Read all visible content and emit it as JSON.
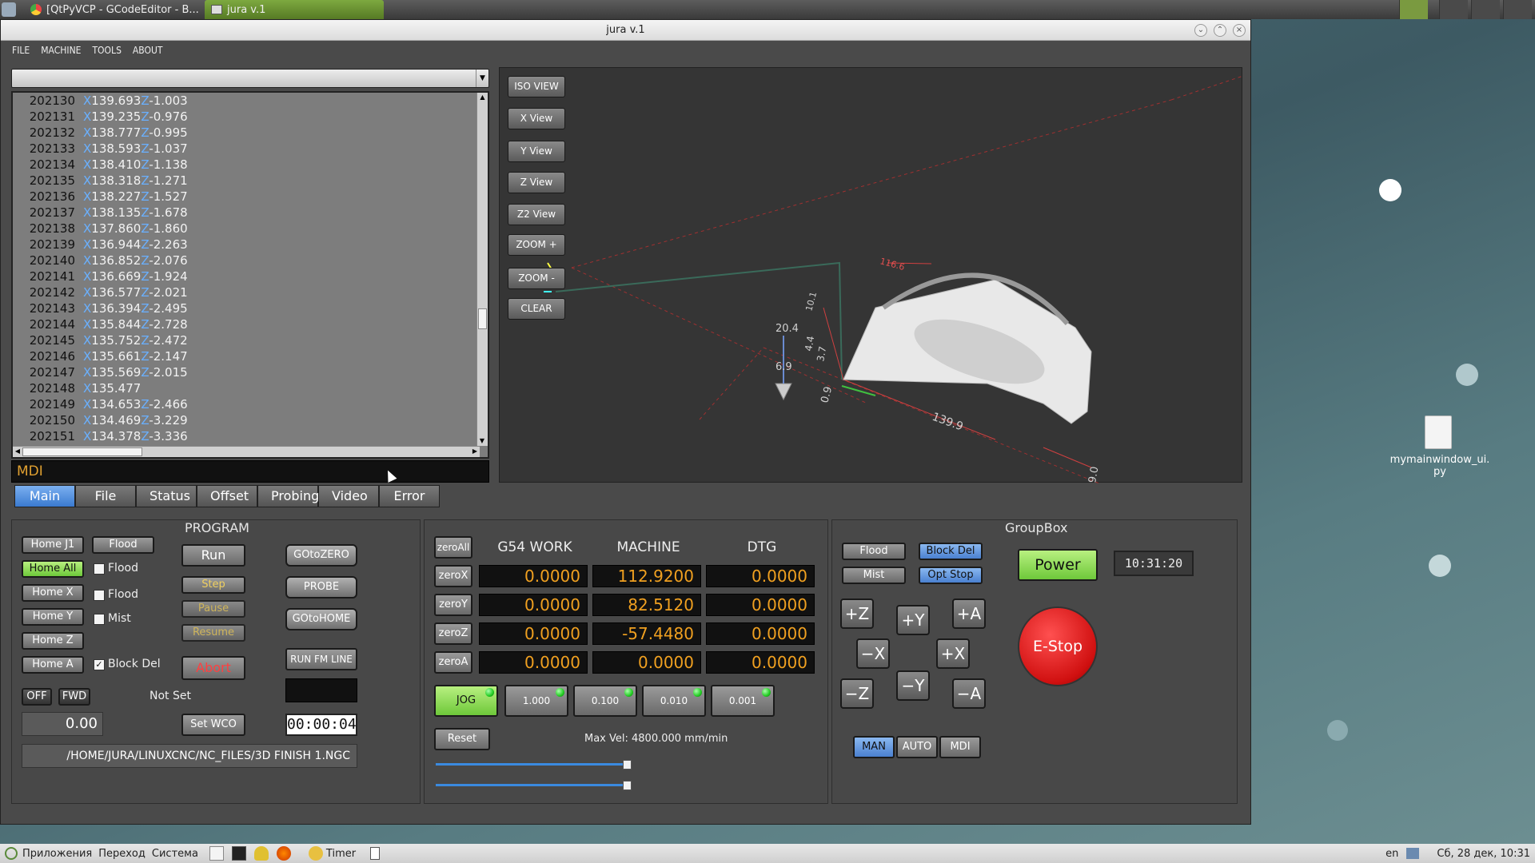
{
  "taskbar_top": {
    "tabs": [
      "[QtPyVCP - GCodeEditor - B...",
      "jura v.1"
    ]
  },
  "window": {
    "title": "jura v.1"
  },
  "menu": [
    "FILE",
    "MACHINE",
    "TOOLS",
    "ABOUT"
  ],
  "gcode_lines": [
    {
      "n": "202130",
      "x": "139.693",
      "z": "-1.003"
    },
    {
      "n": "202131",
      "x": "139.235",
      "z": "-0.976"
    },
    {
      "n": "202132",
      "x": "138.777",
      "z": "-0.995"
    },
    {
      "n": "202133",
      "x": "138.593",
      "z": "-1.037"
    },
    {
      "n": "202134",
      "x": "138.410",
      "z": "-1.138"
    },
    {
      "n": "202135",
      "x": "138.318",
      "z": "-1.271"
    },
    {
      "n": "202136",
      "x": "138.227",
      "z": "-1.527"
    },
    {
      "n": "202137",
      "x": "138.135",
      "z": "-1.678"
    },
    {
      "n": "202138",
      "x": "137.860",
      "z": "-1.860"
    },
    {
      "n": "202139",
      "x": "136.944",
      "z": "-2.263"
    },
    {
      "n": "202140",
      "x": "136.852",
      "z": "-2.076"
    },
    {
      "n": "202141",
      "x": "136.669",
      "z": "-1.924"
    },
    {
      "n": "202142",
      "x": "136.577",
      "z": "-2.021"
    },
    {
      "n": "202143",
      "x": "136.394",
      "z": "-2.495"
    },
    {
      "n": "202144",
      "x": "135.844",
      "z": "-2.728"
    },
    {
      "n": "202145",
      "x": "135.752",
      "z": "-2.472"
    },
    {
      "n": "202146",
      "x": "135.661",
      "z": "-2.147"
    },
    {
      "n": "202147",
      "x": "135.569",
      "z": "-2.015"
    },
    {
      "n": "202148",
      "x": "135.477",
      "z": ""
    },
    {
      "n": "202149",
      "x": "134.653",
      "z": "-2.466"
    },
    {
      "n": "202150",
      "x": "134.469",
      "z": "-3.229"
    },
    {
      "n": "202151",
      "x": "134.378",
      "z": "-3.336"
    }
  ],
  "mdi": {
    "label": "MDI"
  },
  "view_buttons": [
    "ISO VIEW",
    "X View",
    "Y View",
    "Z View",
    "Z2 View",
    "ZOOM +",
    "ZOOM -",
    "CLEAR"
  ],
  "view_labels": {
    "dim1": "116.6",
    "dim2": "20.4",
    "dim3": "6.9",
    "dim4": "0.9",
    "dim5": "139.9",
    "dim6": "9.0",
    "dim7": "10.1",
    "dim8": "4.4",
    "dim9": "3.7"
  },
  "tabs": [
    "Main",
    "File",
    "Status",
    "Offset",
    "Probing",
    "Video",
    "Error"
  ],
  "program": {
    "title": "PROGRAM",
    "home_j1": "Home J1",
    "home_all": "Home All",
    "home_x": "Home X",
    "home_y": "Home Y",
    "home_z": "Home Z",
    "home_a": "Home A",
    "flood_btn": "Flood",
    "flood1": "Flood",
    "flood2": "Flood",
    "mist": "Mist",
    "block_del": "Block Del",
    "run": "Run",
    "step": "Step",
    "pause": "Pause",
    "resume": "Resume",
    "abort": "Abort",
    "goto_zero": "GOtoZERO",
    "probe": "PROBE",
    "goto_home": "GOtoHOME",
    "run_from_line": "RUN FM LINE",
    "off": "OFF",
    "fwd": "FWD",
    "not_set": "Not Set",
    "spindle": "0.00",
    "set_wco": "Set WCO",
    "timer": "00:00:04",
    "file_path": "/HOME/JURA/LINUXCNC/NC_FILES/3D FINISH 1.NGC"
  },
  "dro": {
    "headers": [
      "G54 WORK",
      "MACHINE",
      "DTG"
    ],
    "zero_all": "zeroAll",
    "rows": [
      {
        "btn": "zeroX",
        "work": "0.0000",
        "machine": "112.9200",
        "dtg": "0.0000"
      },
      {
        "btn": "zeroY",
        "work": "0.0000",
        "machine": "82.5120",
        "dtg": "0.0000"
      },
      {
        "btn": "zeroZ",
        "work": "0.0000",
        "machine": "-57.4480",
        "dtg": "0.0000"
      },
      {
        "btn": "zeroA",
        "work": "0.0000",
        "machine": "0.0000",
        "dtg": "0.0000"
      }
    ],
    "jog": "JOG",
    "increments": [
      "1.000",
      "0.100",
      "0.010",
      "0.001"
    ],
    "reset": "Reset",
    "max_vel": "Max Vel: 4800.000 mm/min",
    "slider1": 1.0,
    "slider2": 1.0
  },
  "groupbox": {
    "title": "GroupBox",
    "flood": "Flood",
    "block_del": "Block Del",
    "mist": "Mist",
    "opt_stop": "Opt Stop",
    "power": "Power",
    "clock": "10:31:20",
    "estop": "E-Stop",
    "jog": [
      "+Z",
      "+Y",
      "+A",
      "−X",
      "+X",
      "−Z",
      "−Y",
      "−A"
    ],
    "modes": [
      "MAN",
      "AUTO",
      "MDI"
    ]
  },
  "desktop_file": "mymainwindow_ui.\npy",
  "taskbar_bottom": {
    "apps": "Приложения",
    "go": "Переход",
    "system": "Система",
    "timer": "Timer",
    "lang": "en",
    "datetime": "Сб, 28 дек, 10:31"
  }
}
